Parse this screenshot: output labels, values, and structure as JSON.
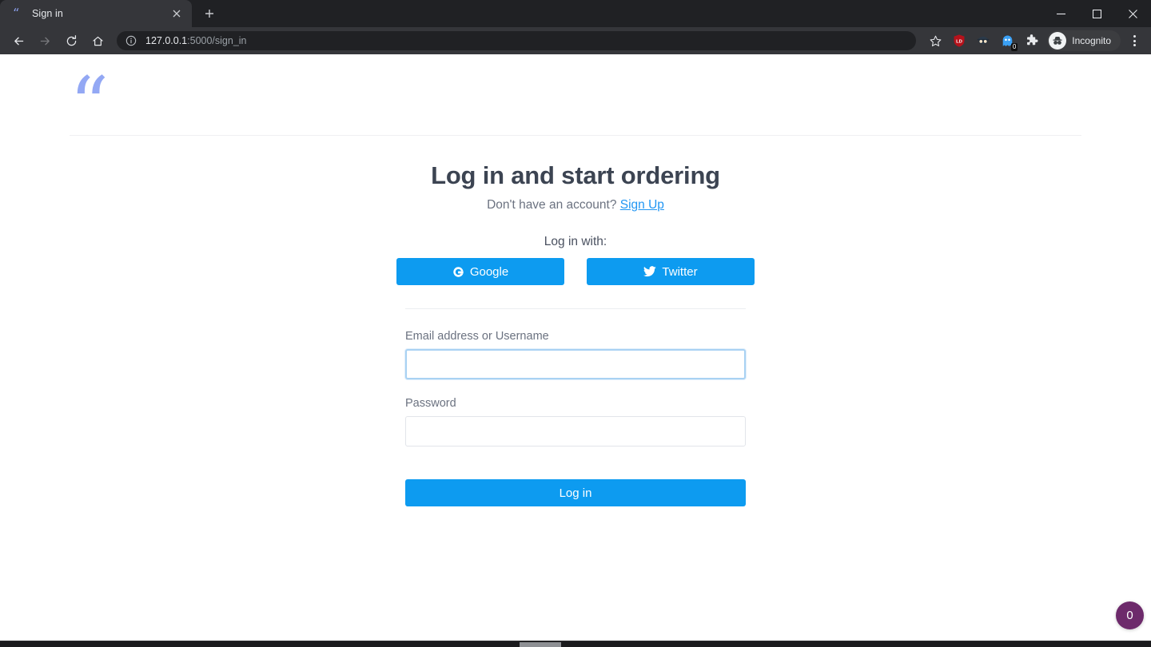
{
  "browser": {
    "tab": {
      "title": "Sign in",
      "favicon_icon": "quote-favicon",
      "close_icon": "close-icon"
    },
    "new_tab_icon": "plus-icon",
    "window_controls": {
      "minimize_icon": "minimize-icon",
      "maximize_icon": "maximize-icon",
      "close_icon": "window-close-icon"
    },
    "nav": {
      "back_icon": "back-arrow-icon",
      "forward_icon": "forward-arrow-icon",
      "reload_icon": "reload-icon",
      "home_icon": "home-icon"
    },
    "omnibox": {
      "info_icon": "info-circle-icon",
      "host": "127.0.0.1",
      "path": ":5000/sign_in",
      "full_url": "127.0.0.1:5000/sign_in"
    },
    "toolbar_icons": [
      {
        "name": "bookmark-star-icon",
        "label": ""
      },
      {
        "name": "ld-shield-extension-icon",
        "label": "LD"
      },
      {
        "name": "detective-extension-icon",
        "label": ""
      },
      {
        "name": "ghost-extension-icon",
        "label": "",
        "badge": "0"
      },
      {
        "name": "extensions-puzzle-icon",
        "label": ""
      }
    ],
    "profile": {
      "avatar_icon": "incognito-avatar-icon",
      "label": "Incognito"
    },
    "menu_icon": "three-dot-menu-icon"
  },
  "page": {
    "brand": {
      "logo_icon": "quote-logo-icon",
      "logo_glyph": "“",
      "logo_color": "#93a8f4"
    },
    "title": "Log in and start ordering",
    "subtitle_text": "Don't have an account?",
    "signup_link": "Sign Up",
    "social_label": "Log in with:",
    "social_buttons": [
      {
        "name": "google-login-button",
        "label": "Google",
        "icon": "google-g-icon",
        "color": "#0d9bf0"
      },
      {
        "name": "twitter-login-button",
        "label": "Twitter",
        "icon": "twitter-bird-icon",
        "color": "#0d9bf0"
      }
    ],
    "form": {
      "email": {
        "label": "Email address or Username",
        "value": "",
        "placeholder": "",
        "focused": true
      },
      "password": {
        "label": "Password",
        "value": "",
        "placeholder": "",
        "focused": false
      },
      "submit_label": "Log in",
      "submit_color": "#0d9bf0"
    },
    "floating_badge": {
      "count": "0",
      "color": "#6d2a6b"
    }
  }
}
